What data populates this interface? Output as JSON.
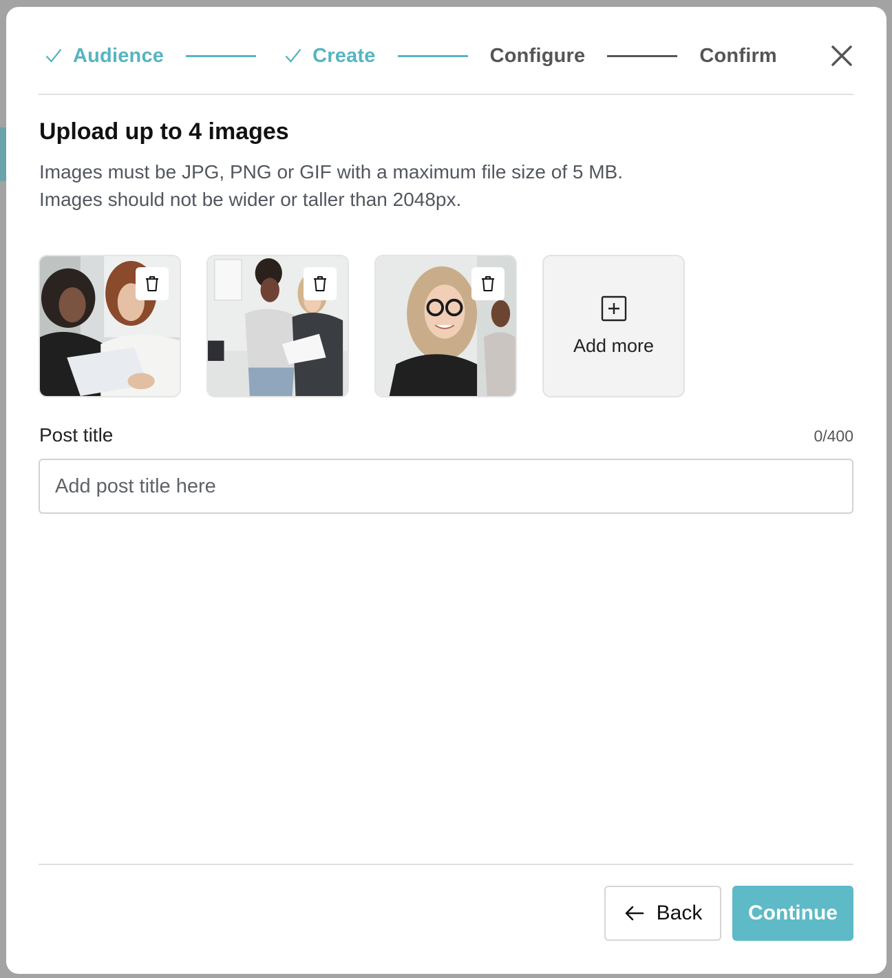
{
  "stepper": {
    "steps": [
      {
        "label": "Audience",
        "status": "done"
      },
      {
        "label": "Create",
        "status": "done"
      },
      {
        "label": "Configure",
        "status": "pending"
      },
      {
        "label": "Confirm",
        "status": "pending"
      }
    ],
    "accent_color": "#57b4c2",
    "pending_color": "#555555"
  },
  "upload": {
    "heading": "Upload up to 4 images",
    "description_line1": "Images must be JPG, PNG or GIF with a maximum file size of 5 MB.",
    "description_line2": "Images should not be wider or taller than 2048px.",
    "images": [
      {
        "icon": "photo-two-women-reviewing-document"
      },
      {
        "icon": "photo-women-discussing-papers"
      },
      {
        "icon": "photo-smiling-woman-glasses"
      }
    ],
    "delete_icon": "trash-icon",
    "add_more_label": "Add more",
    "add_more_icon": "plus-square-icon"
  },
  "post_title": {
    "label": "Post title",
    "counter": "0/400",
    "placeholder": "Add post title here",
    "value": ""
  },
  "footer": {
    "back_label": "Back",
    "back_icon": "arrow-left-icon",
    "continue_label": "Continue",
    "continue_color": "#5dbac6"
  }
}
